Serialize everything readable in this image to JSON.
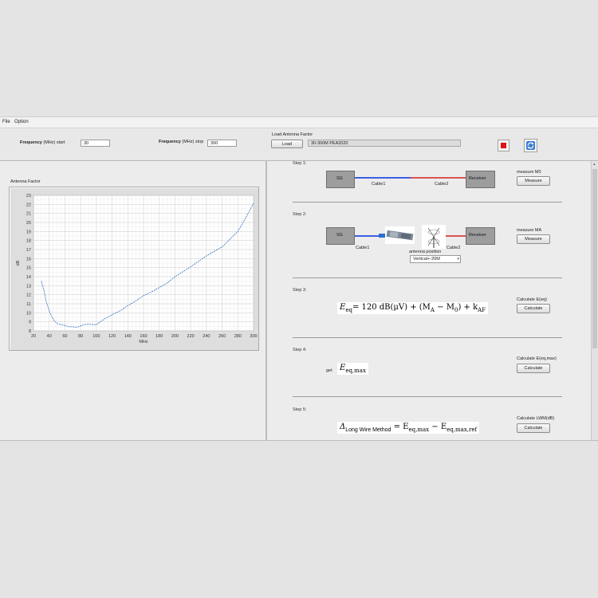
{
  "menu": {
    "file": "File",
    "option": "Option"
  },
  "toolbar": {
    "freq_start_label_bold": "Frequency",
    "freq_start_label_rest": "(MHz) start",
    "freq_start_value": "30",
    "freq_stop_label_bold": "Frequency",
    "freq_stop_label_rest": "(MHz) stop",
    "freq_stop_value": "300",
    "load_caption": "Load Antenna Factor",
    "load_button": "Load",
    "load_path": "30-300M PEA2020",
    "stop_color": "#e01010",
    "refresh_color": "#3b7fd6"
  },
  "graph": {
    "title": "Antenna Factor",
    "xlabel": "MHz",
    "ylabel": "dB",
    "line_color": "#2f6fc0"
  },
  "chart_data": {
    "type": "line",
    "title": "Antenna Factor",
    "xlabel": "MHz",
    "ylabel": "dB",
    "xlim": [
      20,
      300
    ],
    "ylim": [
      8,
      23
    ],
    "x_ticks": [
      20,
      40,
      60,
      80,
      100,
      120,
      140,
      160,
      180,
      200,
      220,
      240,
      260,
      280,
      300
    ],
    "y_ticks": [
      8,
      9,
      10,
      11,
      12,
      13,
      14,
      15,
      16,
      17,
      18,
      19,
      20,
      21,
      22,
      23
    ],
    "grid": true,
    "series": [
      {
        "x": [
          30,
          33,
          36,
          40,
          45,
          50,
          55,
          60,
          65,
          70,
          75,
          80,
          85,
          90,
          95,
          100,
          110,
          120,
          130,
          140,
          150,
          160,
          170,
          180,
          190,
          200,
          220,
          240,
          260,
          280,
          290,
          300
        ],
        "values": [
          13.5,
          12.6,
          11.3,
          10.2,
          9.3,
          8.8,
          8.7,
          8.6,
          8.45,
          8.45,
          8.4,
          8.55,
          8.7,
          8.75,
          8.7,
          8.7,
          9.3,
          9.8,
          10.2,
          10.8,
          11.3,
          11.9,
          12.3,
          12.8,
          13.3,
          14.0,
          15.1,
          16.3,
          17.3,
          19.0,
          20.5,
          22.1
        ]
      }
    ]
  },
  "steps": {
    "step1": {
      "label": "Step 1:",
      "sg": "SG",
      "cable1": "Cable1",
      "cable2": "Cable2",
      "receiver": "Receiver",
      "action_label": "measure M0",
      "button": "Measure"
    },
    "step2": {
      "label": "Step 2:",
      "sg": "SG",
      "cable1": "Cable1",
      "cable2": "Cable2",
      "receiver": "Receiver",
      "antenna_position_label": "antenna position",
      "antenna_position_value": "Vertical+-20M",
      "action_label": "measure MA",
      "button": "Measure"
    },
    "step3": {
      "label": "Step 3:",
      "action_label": "Calculate E(eq)",
      "button": "Calculate",
      "formula_lhs": "E",
      "formula_lhs_sub": "eq",
      "formula_rhs": "= 120 dB(μV) + (M",
      "formula_ma_sub": "A",
      "formula_mid": " − M",
      "formula_m0_sub": "0",
      "formula_end": ") + k",
      "formula_kaf_sub": "AF"
    },
    "step4": {
      "label": "Step 4:",
      "get_label": "get",
      "formula_lhs": "E",
      "formula_lhs_sub": "eq,max",
      "action_label": "Calculate E(eq,max)",
      "button": "Calculate"
    },
    "step5": {
      "label": "Step 5:",
      "formula_delta": "Δ",
      "formula_delta_sub": "Long Wire Method",
      "formula_eq": " = E",
      "formula_eq_sub": "eq,max",
      "formula_minus": " − E",
      "formula_ref_sub": "eq,max,ref",
      "action_label": "Calculate LWM(dB)",
      "button": "Calculate"
    }
  }
}
